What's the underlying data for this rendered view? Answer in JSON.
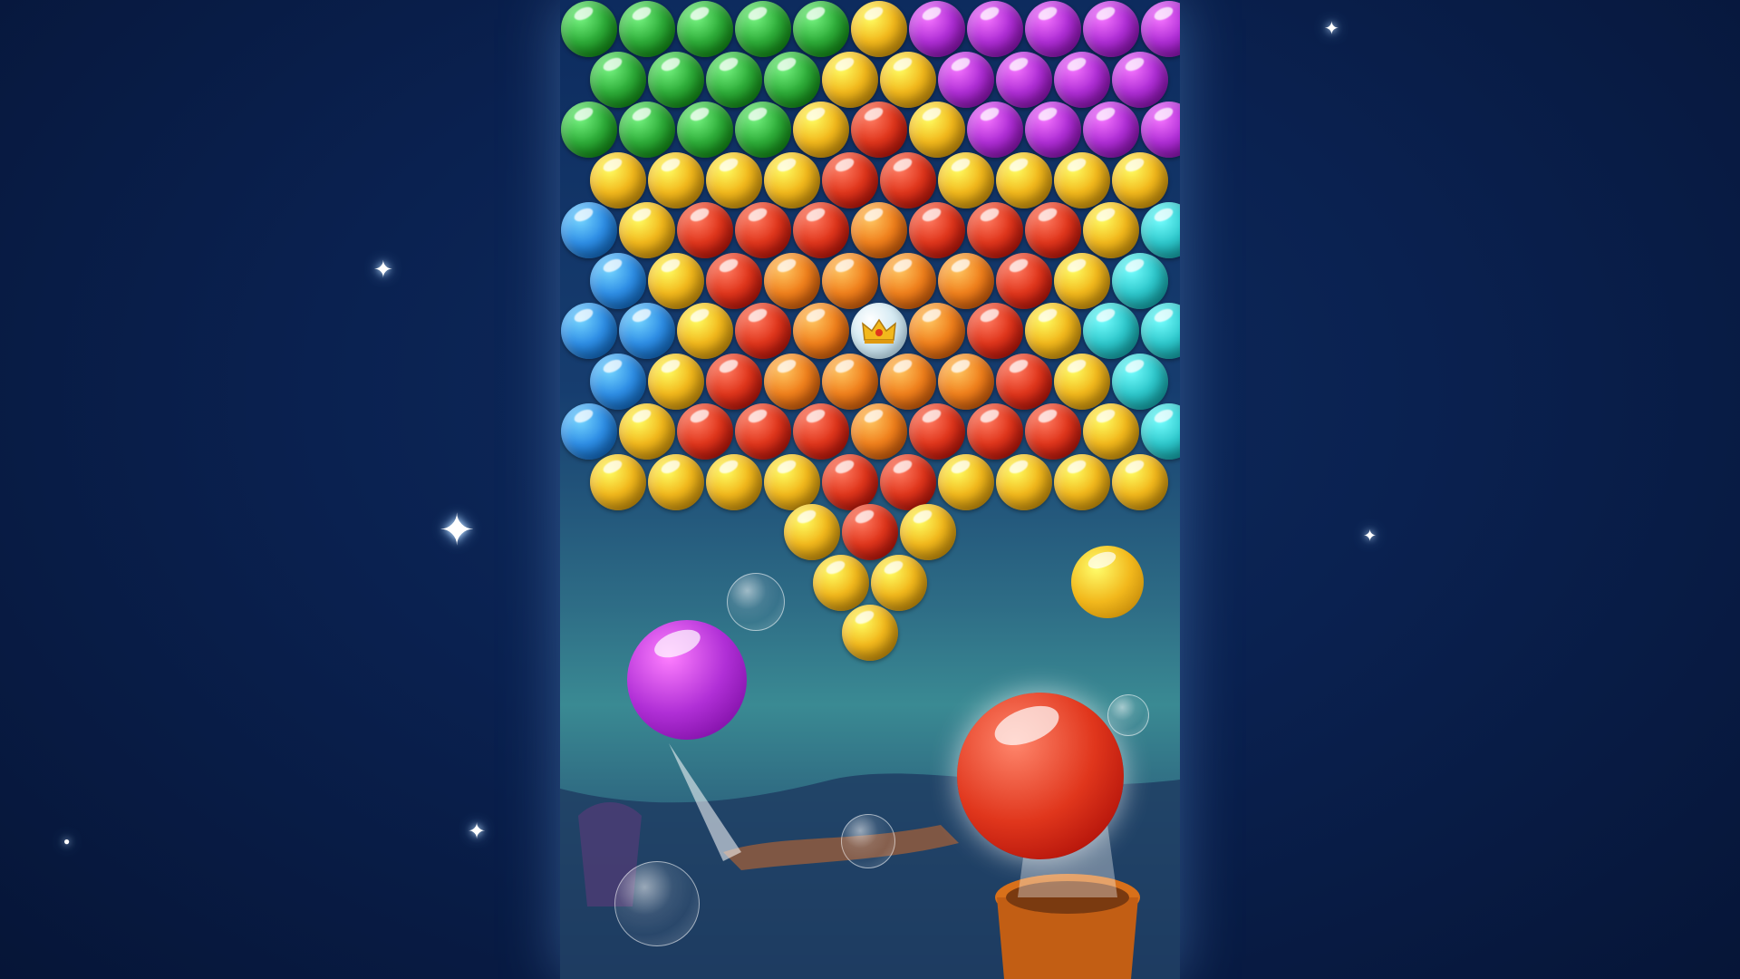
{
  "scene": {
    "crown_icon": "crown-icon",
    "colors": {
      "green": "#2fae3a",
      "yellow": "#f2b81c",
      "purple": "#b02fd6",
      "red": "#e0361c",
      "orange": "#f0801c",
      "blue": "#2f8fe6",
      "cyan": "#2fc8cc"
    },
    "bubble_rows": [
      [
        "green",
        "green",
        "green",
        "green",
        "green",
        "yellow",
        "purple",
        "purple",
        "purple",
        "purple",
        "purple"
      ],
      [
        "green",
        "green",
        "green",
        "green",
        "yellow",
        "yellow",
        "purple",
        "purple",
        "purple",
        "purple"
      ],
      [
        "green",
        "green",
        "green",
        "green",
        "yellow",
        "red",
        "yellow",
        "purple",
        "purple",
        "purple",
        "purple"
      ],
      [
        "yellow",
        "yellow",
        "yellow",
        "yellow",
        "red",
        "red",
        "yellow",
        "yellow",
        "yellow",
        "yellow"
      ],
      [
        "blue",
        "yellow",
        "red",
        "red",
        "red",
        "orange",
        "red",
        "red",
        "red",
        "yellow",
        "cyan"
      ],
      [
        "blue",
        "yellow",
        "red",
        "orange",
        "orange",
        "orange",
        "orange",
        "red",
        "yellow",
        "cyan"
      ],
      [
        "blue",
        "blue",
        "yellow",
        "red",
        "orange",
        "crown",
        "orange",
        "red",
        "yellow",
        "cyan",
        "cyan"
      ],
      [
        "blue",
        "yellow",
        "red",
        "orange",
        "orange",
        "orange",
        "orange",
        "red",
        "yellow",
        "cyan"
      ],
      [
        "blue",
        "yellow",
        "red",
        "red",
        "red",
        "orange",
        "red",
        "red",
        "red",
        "yellow",
        "cyan"
      ],
      [
        "yellow",
        "yellow",
        "yellow",
        "yellow",
        "red",
        "red",
        "yellow",
        "yellow",
        "yellow",
        "yellow"
      ],
      [
        "yellow",
        "red",
        "yellow"
      ],
      [
        "yellow",
        "yellow"
      ],
      [
        "yellow"
      ]
    ],
    "decor_balls": [
      {
        "name": "purple-flying-ball",
        "color": "purple"
      },
      {
        "name": "yellow-flying-ball",
        "color": "yellow"
      },
      {
        "name": "red-shooter-ball",
        "color": "red"
      }
    ]
  }
}
